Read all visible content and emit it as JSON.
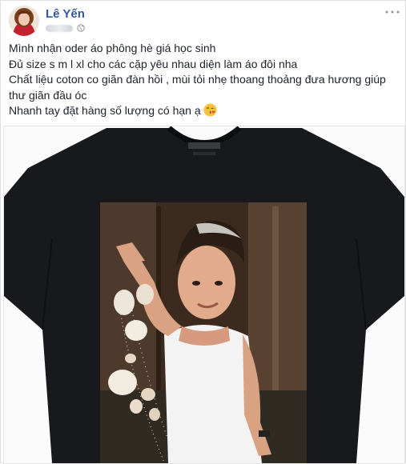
{
  "post": {
    "author": "Lê Yến",
    "caption": [
      "Mình nhận oder áo phông hè giá học sinh",
      "Đủ size s m l xl cho các cặp yêu nhau diện làm áo đôi nha",
      "Chất liệu coton co giãn đàn hồi , mùi tỏi nhẹ thoang thoảng đưa hương giúp",
      "thư giãn đầu óc",
      "Nhanh tay đặt hàng số lượng có hạn ạ"
    ],
    "icons": {
      "avatar": "avatar-photo",
      "privacy": "globe-icon",
      "more": "more-options-icon",
      "emoji": "kiss-emoji-icon"
    },
    "colors": {
      "author": "#365899",
      "text": "#1d2129",
      "shirt": "#17191c"
    }
  }
}
